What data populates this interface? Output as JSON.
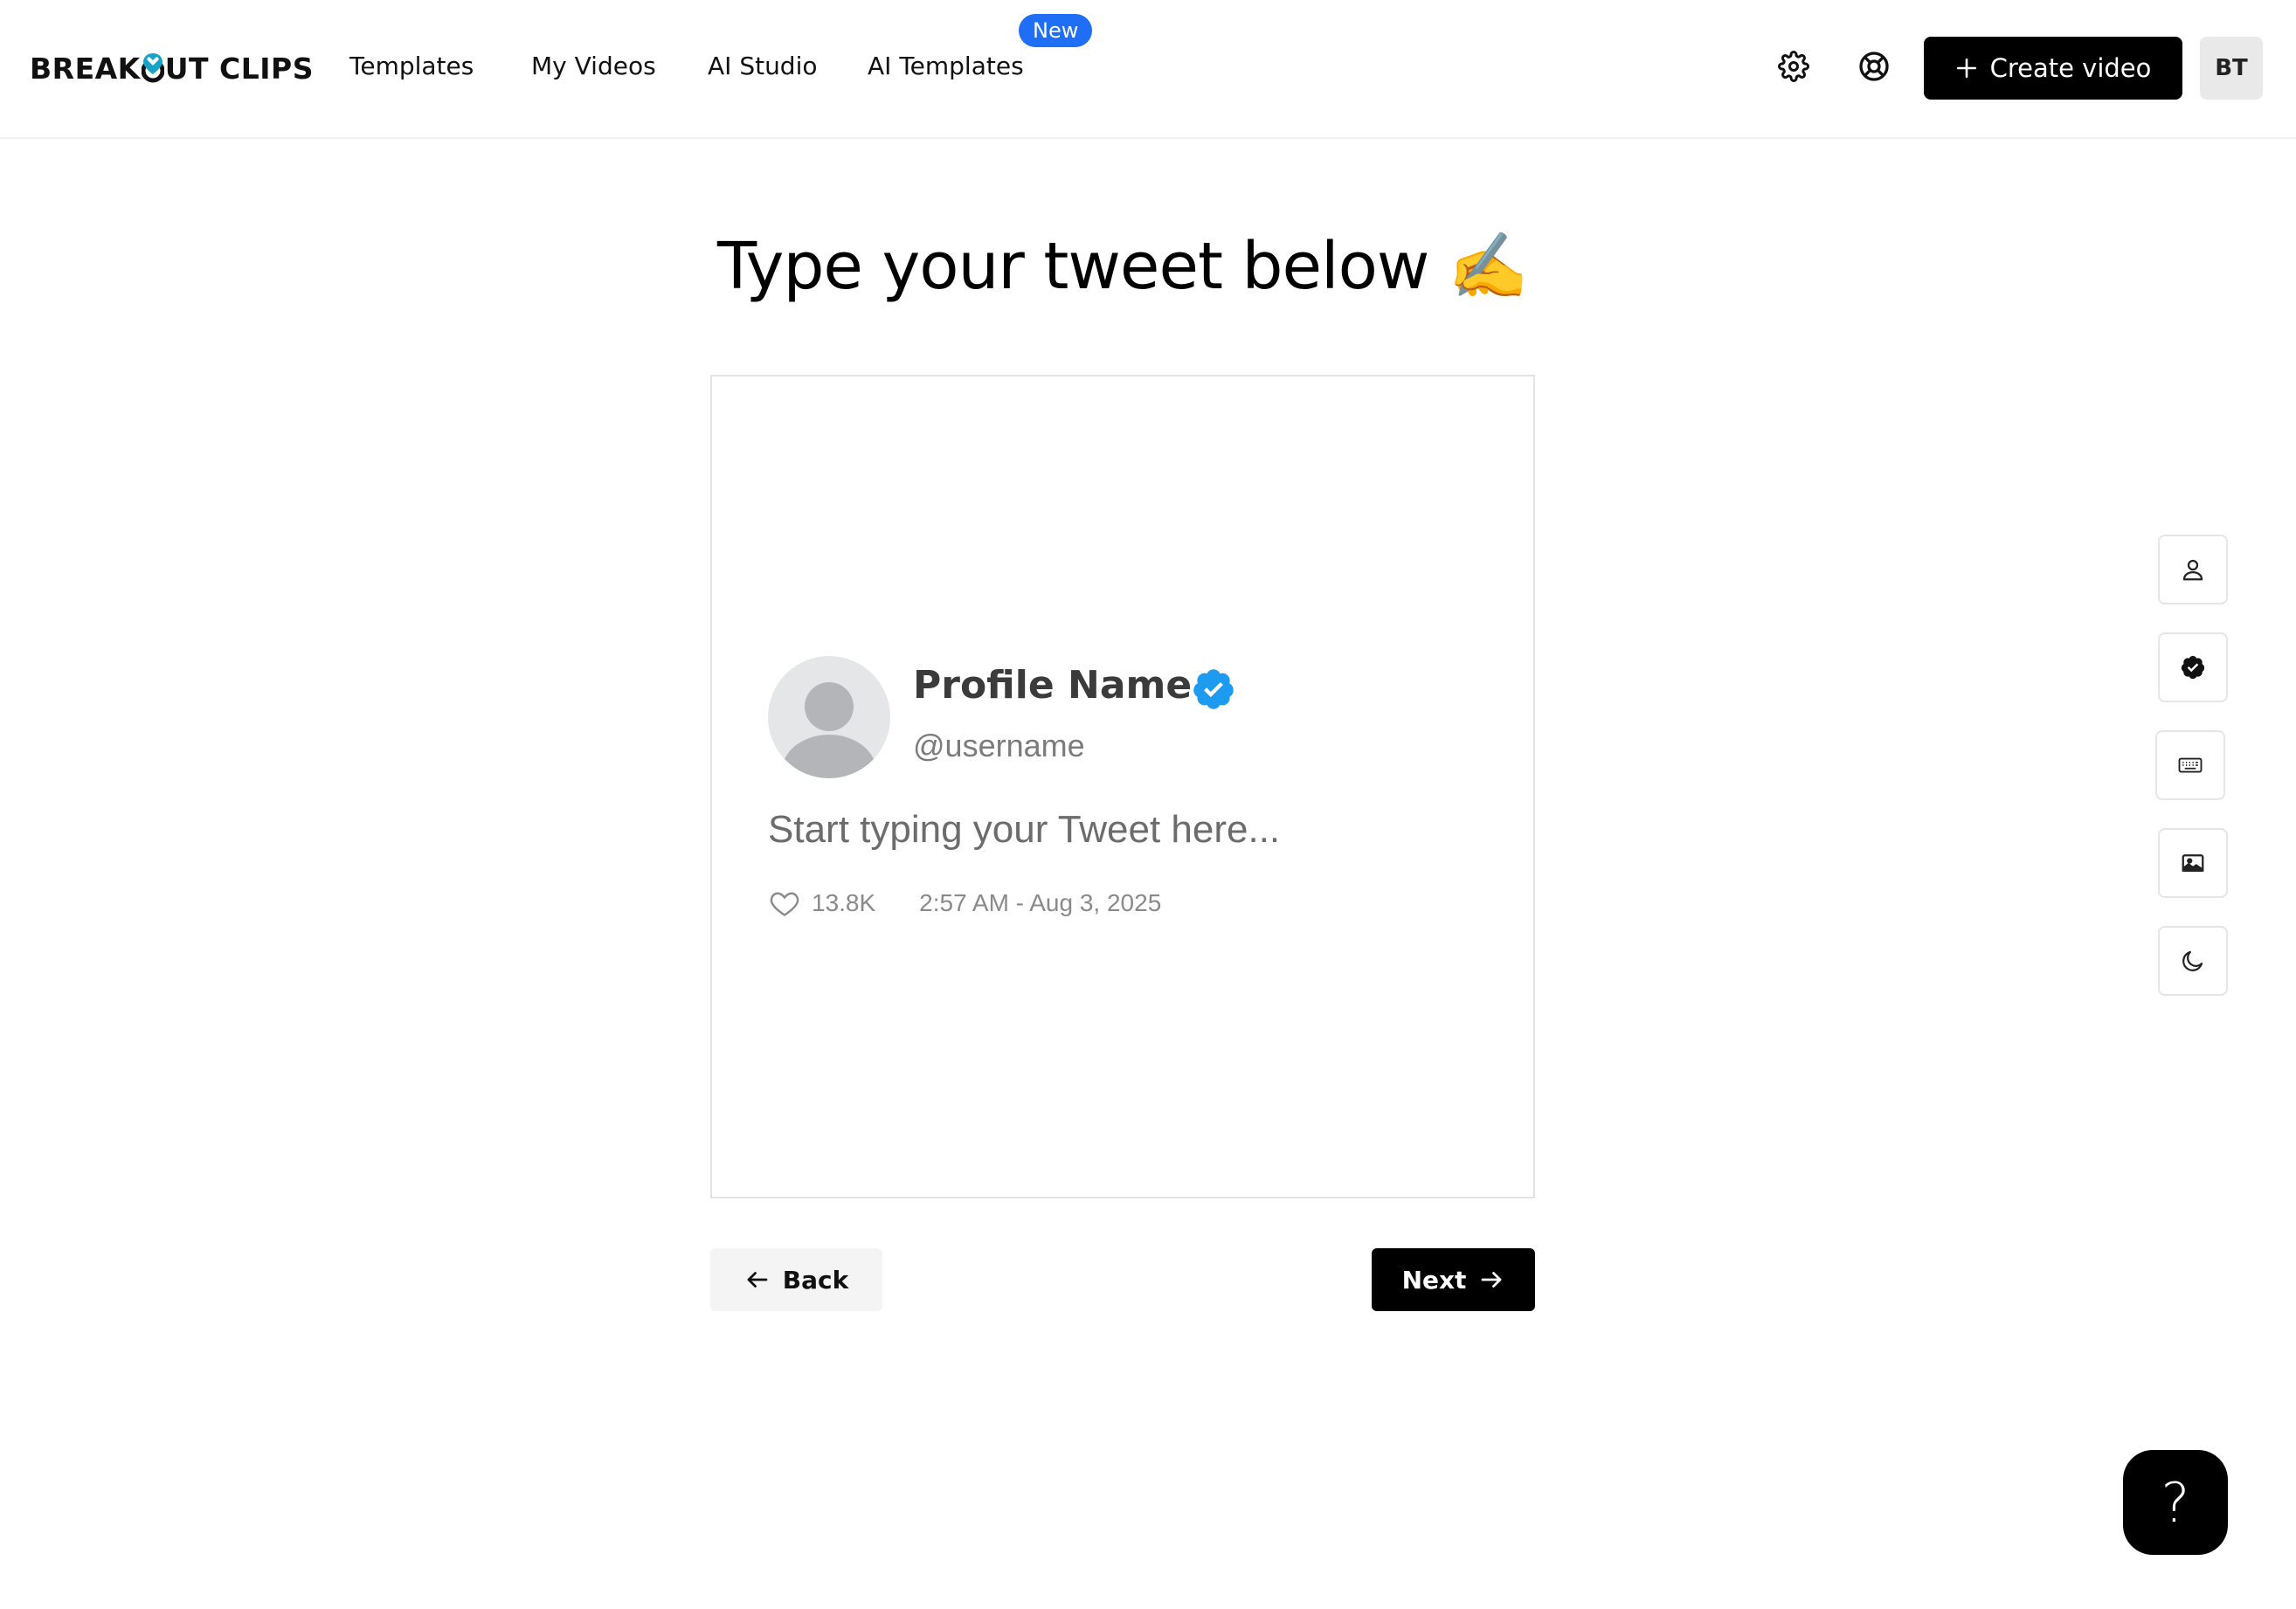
{
  "header": {
    "logo_text_left": "BREAK",
    "logo_text_right": "UT CLIPS",
    "nav": [
      {
        "label": "Templates"
      },
      {
        "label": "My Videos"
      },
      {
        "label": "AI Studio"
      },
      {
        "label": "AI Templates"
      }
    ],
    "new_badge": "New",
    "settings_icon": "gear-icon",
    "support_icon": "lifebuoy-icon",
    "create_button": "Create video",
    "user_initials": "BT"
  },
  "main": {
    "title": "Type your tweet below ✍️",
    "tweet": {
      "profile_name": "Profile Name",
      "username": "@username",
      "placeholder": "Start typing your Tweet here...",
      "likes": "13.8K",
      "timestamp": "2:57 AM - Aug 3, 2025",
      "verified_color": "#1d9bf0"
    },
    "back_button": "Back",
    "next_button": "Next"
  },
  "toolbar": {
    "tools": [
      "user-icon",
      "verified-badge-icon",
      "keyboard-icon",
      "image-icon",
      "moon-icon"
    ]
  },
  "help": {
    "label": "?"
  },
  "colors": {
    "accent": "#1e6ff5",
    "primary_button": "#000000"
  }
}
